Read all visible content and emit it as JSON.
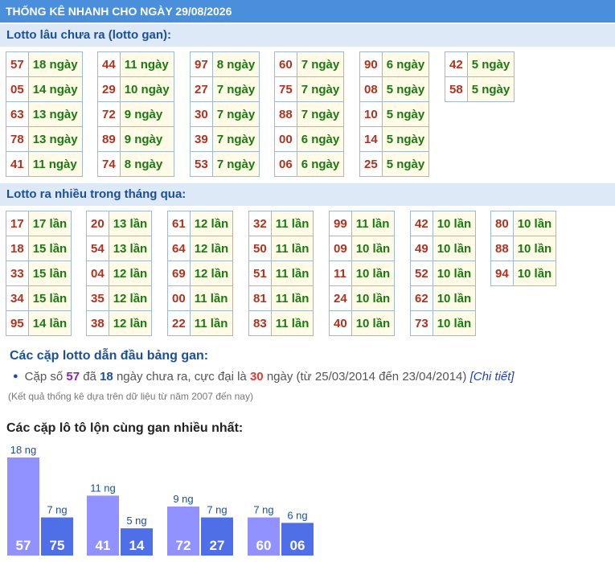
{
  "header": {
    "title": "THỐNG KÊ NHANH CHO NGÀY 29/08/2026"
  },
  "gan_section": {
    "title": "Lotto lâu chưa ra (lotto gan):",
    "columns": [
      [
        [
          "57",
          "18 ngày"
        ],
        [
          "05",
          "14 ngày"
        ],
        [
          "63",
          "13 ngày"
        ],
        [
          "78",
          "13 ngày"
        ],
        [
          "41",
          "11 ngày"
        ]
      ],
      [
        [
          "44",
          "11 ngày"
        ],
        [
          "29",
          "10 ngày"
        ],
        [
          "72",
          "9 ngày"
        ],
        [
          "89",
          "9 ngày"
        ],
        [
          "74",
          "8 ngày"
        ]
      ],
      [
        [
          "97",
          "8 ngày"
        ],
        [
          "27",
          "7 ngày"
        ],
        [
          "30",
          "7 ngày"
        ],
        [
          "39",
          "7 ngày"
        ],
        [
          "53",
          "7 ngày"
        ]
      ],
      [
        [
          "60",
          "7 ngày"
        ],
        [
          "75",
          "7 ngày"
        ],
        [
          "88",
          "7 ngày"
        ],
        [
          "00",
          "6 ngày"
        ],
        [
          "06",
          "6 ngày"
        ]
      ],
      [
        [
          "90",
          "6 ngày"
        ],
        [
          "08",
          "5 ngày"
        ],
        [
          "10",
          "5 ngày"
        ],
        [
          "14",
          "5 ngày"
        ],
        [
          "25",
          "5 ngày"
        ]
      ],
      [
        [
          "42",
          "5 ngày"
        ],
        [
          "58",
          "5 ngày"
        ]
      ]
    ]
  },
  "frequent_section": {
    "title": "Lotto ra nhiều trong tháng qua:",
    "columns": [
      [
        [
          "17",
          "17 lần"
        ],
        [
          "18",
          "15 lần"
        ],
        [
          "33",
          "15 lần"
        ],
        [
          "34",
          "15 lần"
        ],
        [
          "95",
          "14 lần"
        ]
      ],
      [
        [
          "20",
          "13 lần"
        ],
        [
          "54",
          "13 lần"
        ],
        [
          "04",
          "12 lần"
        ],
        [
          "35",
          "12 lần"
        ],
        [
          "38",
          "12 lần"
        ]
      ],
      [
        [
          "61",
          "12 lần"
        ],
        [
          "64",
          "12 lần"
        ],
        [
          "69",
          "12 lần"
        ],
        [
          "00",
          "11 lần"
        ],
        [
          "22",
          "11 lần"
        ]
      ],
      [
        [
          "32",
          "11 lần"
        ],
        [
          "50",
          "11 lần"
        ],
        [
          "51",
          "11 lần"
        ],
        [
          "81",
          "11 lần"
        ],
        [
          "83",
          "11 lần"
        ]
      ],
      [
        [
          "99",
          "11 lần"
        ],
        [
          "09",
          "10 lần"
        ],
        [
          "11",
          "10 lần"
        ],
        [
          "24",
          "10 lần"
        ],
        [
          "40",
          "10 lần"
        ]
      ],
      [
        [
          "42",
          "10 lần"
        ],
        [
          "49",
          "10 lần"
        ],
        [
          "52",
          "10 lần"
        ],
        [
          "62",
          "10 lần"
        ],
        [
          "73",
          "10 lần"
        ]
      ],
      [
        [
          "80",
          "10 lần"
        ],
        [
          "88",
          "10 lần"
        ],
        [
          "94",
          "10 lần"
        ]
      ]
    ]
  },
  "pair_section": {
    "title": "Các cặp lotto dẫn đầu bảng gan:",
    "line": {
      "prefix": "Cặp số",
      "pair": "57",
      "mid1": "đã",
      "days": "18",
      "mid2": "ngày chưa ra, cực đại là",
      "max": "30",
      "suffix": "ngày (từ 25/03/2014 đến 23/04/2014)",
      "link": "[Chi tiết]"
    },
    "note": "(Kết quả thống kê dựa trên dữ liệu từ năm 2007 đến nay)"
  },
  "colors": {
    "header_bg": "#4a8fdc",
    "section_bg": "#dde9f7",
    "number": "#b3311d",
    "value": "#1a7a12",
    "bar_light": "#9191ff",
    "bar_dark": "#4f6fe8"
  },
  "chart_data": {
    "type": "bar",
    "title": "Các cặp lô tô lộn cùng gan nhiều nhất:",
    "groups": [
      {
        "bars": [
          {
            "label": "57",
            "value": 18,
            "value_label": "18 ng"
          },
          {
            "label": "75",
            "value": 7,
            "value_label": "7 ng"
          }
        ]
      },
      {
        "bars": [
          {
            "label": "41",
            "value": 11,
            "value_label": "11 ng"
          },
          {
            "label": "14",
            "value": 5,
            "value_label": "5 ng"
          }
        ]
      },
      {
        "bars": [
          {
            "label": "72",
            "value": 9,
            "value_label": "9 ng"
          },
          {
            "label": "27",
            "value": 7,
            "value_label": "7 ng"
          }
        ]
      },
      {
        "bars": [
          {
            "label": "60",
            "value": 7,
            "value_label": "7 ng"
          },
          {
            "label": "06",
            "value": 6,
            "value_label": "6 ng"
          }
        ]
      }
    ],
    "ylim": [
      0,
      18
    ]
  }
}
